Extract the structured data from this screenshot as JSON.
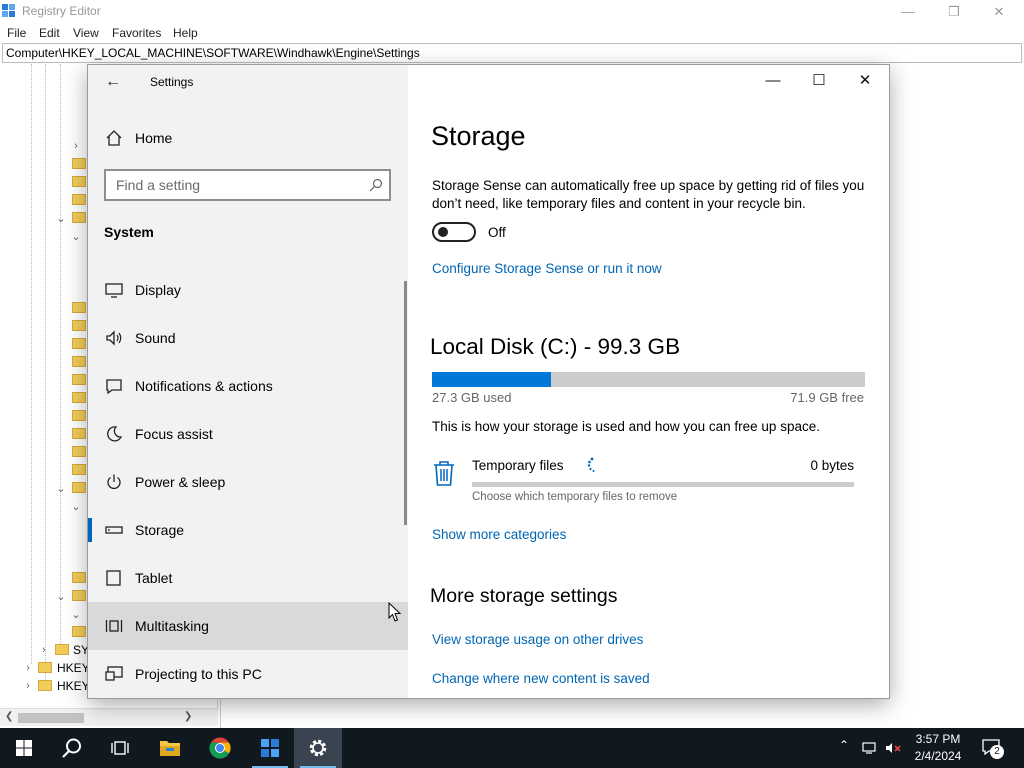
{
  "regedit": {
    "title": "Registry Editor",
    "menu": [
      "File",
      "Edit",
      "View",
      "Favorites",
      "Help"
    ],
    "address": "Computer\\HKEY_LOCAL_MACHINE\\SOFTWARE\\Windhawk\\Engine\\Settings",
    "tree_visible_text": [
      "SY",
      "HKEY",
      "HKEY"
    ]
  },
  "settings": {
    "window_title": "Settings",
    "home_label": "Home",
    "search_placeholder": "Find a setting",
    "section_title": "System",
    "nav": [
      {
        "label": "Display",
        "icon": "monitor-icon"
      },
      {
        "label": "Sound",
        "icon": "speaker-icon"
      },
      {
        "label": "Notifications & actions",
        "icon": "notification-icon"
      },
      {
        "label": "Focus assist",
        "icon": "moon-icon"
      },
      {
        "label": "Power & sleep",
        "icon": "power-icon"
      },
      {
        "label": "Storage",
        "icon": "storage-icon",
        "selected": true
      },
      {
        "label": "Tablet",
        "icon": "tablet-icon"
      },
      {
        "label": "Multitasking",
        "icon": "multitasking-icon",
        "hovered": true
      },
      {
        "label": "Projecting to this PC",
        "icon": "projecting-icon"
      }
    ],
    "page": {
      "title": "Storage",
      "sense_description": "Storage Sense can automatically free up space by getting rid of files you don’t need, like temporary files and content in your recycle bin.",
      "toggle_state": "Off",
      "configure_link": "Configure Storage Sense or run it now",
      "disk_title": "Local Disk (C:) - 99.3 GB",
      "disk_used_fraction": 0.275,
      "disk_used": "27.3 GB used",
      "disk_free": "71.9 GB free",
      "disk_description": "This is how your storage is used and how you can free up space.",
      "category": {
        "title": "Temporary files",
        "size": "0 bytes",
        "description": "Choose which temporary files to remove"
      },
      "show_more_link": "Show more categories",
      "more_title": "More storage settings",
      "more_links": [
        "View storage usage on other drives",
        "Change where new content is saved"
      ]
    }
  },
  "taskbar": {
    "apps": [
      "start-icon",
      "search-icon",
      "task-view-icon",
      "file-explorer-icon",
      "chrome-icon",
      "registry-editor-icon",
      "settings-icon"
    ],
    "time": "3:57 PM",
    "date": "2/4/2024",
    "notification_count": "2"
  },
  "colors": {
    "accent": "#0078d7",
    "link": "#0066b4",
    "taskbar": "#101820",
    "sidebar": "#f2f2f2"
  }
}
